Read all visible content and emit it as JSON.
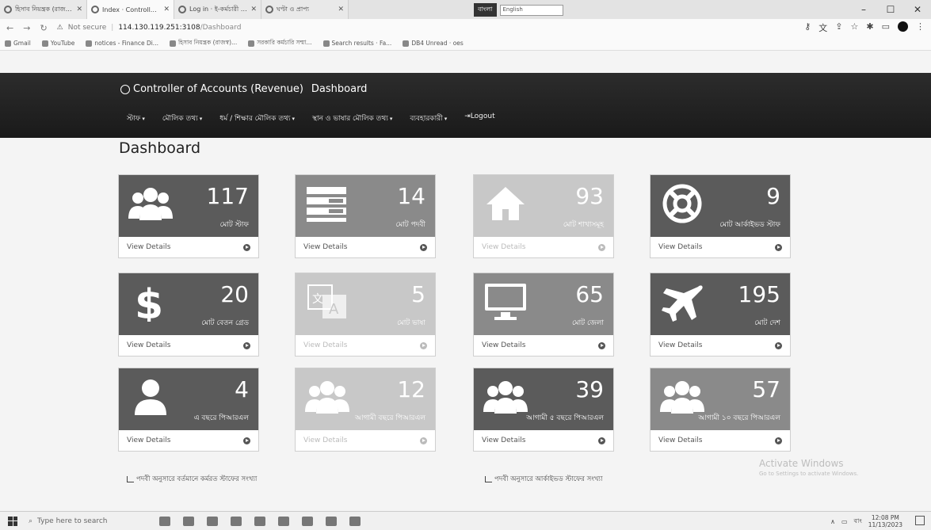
{
  "browser": {
    "tabs": [
      {
        "label": "হিসাব নিয়ন্ত্রক (রাজস্ব) এর দপ্তর",
        "active": false
      },
      {
        "label": "Index · Controller of Accounts",
        "active": true
      },
      {
        "label": "Log in · ই-কর্মচারী ব্যবস্থাপনা",
        "active": false
      },
      {
        "label": "ঘণ্টা ও প্রাপ্য",
        "active": false
      }
    ],
    "keyboard_indicator": "বাংলা",
    "language_select": "English",
    "url": {
      "security": "Not secure",
      "host": "114.130.119.251:3108",
      "path": "/Dashboard"
    },
    "bookmarks": [
      "Gmail",
      "YouTube",
      "notices - Finance Di...",
      "হিসাব নিয়ন্ত্রক (রাজস্ব)...",
      "সরকারি কর্মচারি সম্মা...",
      "Search results · Fa...",
      "DB4 Unread · oes"
    ]
  },
  "app": {
    "brand": "Controller of Accounts (Revenue)",
    "brand_link": "Dashboard",
    "menu": [
      {
        "label": "স্টাফ",
        "caret": true
      },
      {
        "label": "মৌলিক তথ্য",
        "caret": true
      },
      {
        "label": "ধর্ম / শিক্ষার মৌলিক তথ্য",
        "caret": true
      },
      {
        "label": "স্থান ও ভাষার মৌলিক তথ্য",
        "caret": true
      },
      {
        "label": "ব্যবহারকারী",
        "caret": true
      },
      {
        "label": "Logout",
        "caret": false
      }
    ],
    "page_title": "Dashboard",
    "cards": [
      {
        "icon": "users-icon",
        "value": "117",
        "caption": "মোট স্টাফ",
        "link": "View Details",
        "style": "dark"
      },
      {
        "icon": "list-icon",
        "value": "14",
        "caption": "মোট পদবী",
        "link": "View Details",
        "style": "mid"
      },
      {
        "icon": "home-icon",
        "value": "93",
        "caption": "মোট শাখাসমূহ",
        "link": "View Details",
        "style": "faded"
      },
      {
        "icon": "lifebuoy-icon",
        "value": "9",
        "caption": "মোট আর্কাইভড স্টাফ",
        "link": "View Details",
        "style": "dark"
      },
      {
        "icon": "dollar-icon",
        "value": "20",
        "caption": "মোট বেতন গ্রেড",
        "link": "View Details",
        "style": "dark"
      },
      {
        "icon": "language-icon",
        "value": "5",
        "caption": "মোট ভাষা",
        "link": "View Details",
        "style": "faded"
      },
      {
        "icon": "monitor-icon",
        "value": "65",
        "caption": "মোট জেলা",
        "link": "View Details",
        "style": "mid"
      },
      {
        "icon": "plane-icon",
        "value": "195",
        "caption": "মোট দেশ",
        "link": "View Details",
        "style": "dark"
      },
      {
        "icon": "user-icon",
        "value": "4",
        "caption": "এ বছরে পিআরএল",
        "link": "View Details",
        "style": "dark"
      },
      {
        "icon": "users-icon",
        "value": "12",
        "caption": "আগামী বছরে পিআরএল",
        "link": "View Details",
        "style": "faded"
      },
      {
        "icon": "users-icon",
        "value": "39",
        "caption": "আগামী ৫ বছরে পিআরএল",
        "link": "View Details",
        "style": "dark"
      },
      {
        "icon": "users-icon",
        "value": "57",
        "caption": "আগামী ১০ বছরে পিআরএল",
        "link": "View Details",
        "style": "mid"
      }
    ],
    "chart_headings": [
      "পদবী অনুসারে বর্তমানে কর্মরত স্টাফের সংখ্যা",
      "পদবী অনুসারে আর্কাইভড স্টাফের সংখ্যা"
    ],
    "watermark": {
      "title": "Activate Windows",
      "subtitle": "Go to Settings to activate Windows."
    }
  },
  "taskbar": {
    "search_placeholder": "Type here to search",
    "lang": "বাং",
    "time": "12:08 PM",
    "date": "11/13/2023"
  }
}
